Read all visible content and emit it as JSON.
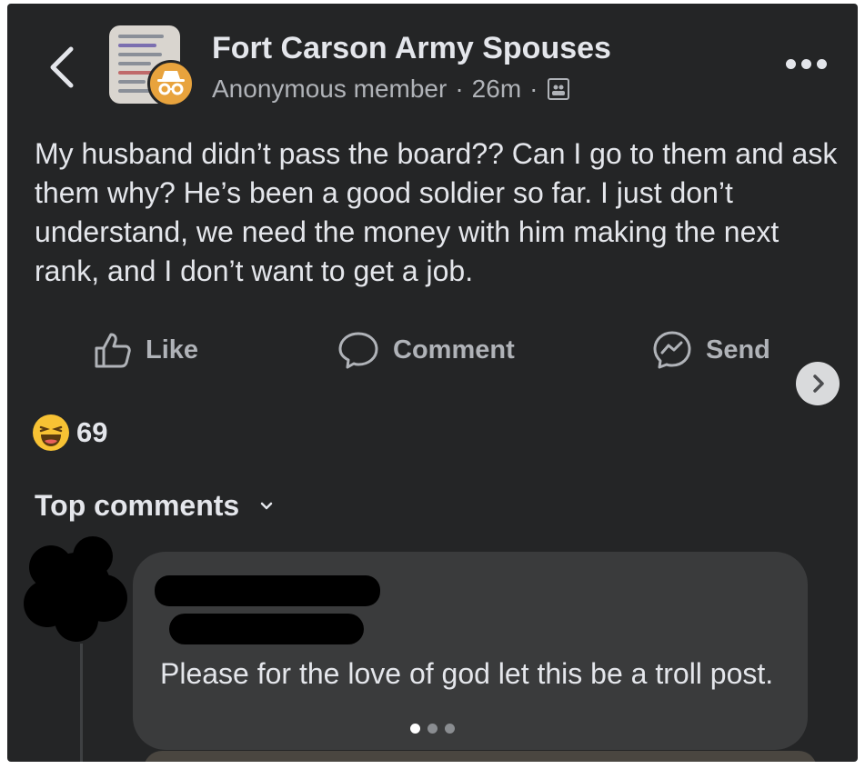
{
  "post": {
    "group_name": "Fort Carson Army Spouses",
    "author": "Anonymous member",
    "separator": "·",
    "time": "26m",
    "privacy_icon": "group-privacy-icon",
    "text": "My husband didn’t pass the board?? Can I go to them and ask them why? He’s been a good soldier so far. I just don’t understand, we need the money with him making the next rank, and I don’t want to get a job."
  },
  "actions": {
    "like": "Like",
    "comment": "Comment",
    "send": "Send"
  },
  "reactions": {
    "icon": "haha-reaction-icon",
    "count": "69"
  },
  "comments": {
    "sort_label": "Top comments",
    "first": {
      "text": "Please for the love of god let this be a troll post."
    },
    "pager": {
      "count": 3,
      "active": 1
    }
  },
  "colors": {
    "background": "#242526",
    "primary_text": "#e4e6eb",
    "secondary_text": "#b0b3b8",
    "bubble": "#3a3b3c",
    "anonymous_avatar": "#e8a33d",
    "haha_yellow": "#f7c234"
  }
}
